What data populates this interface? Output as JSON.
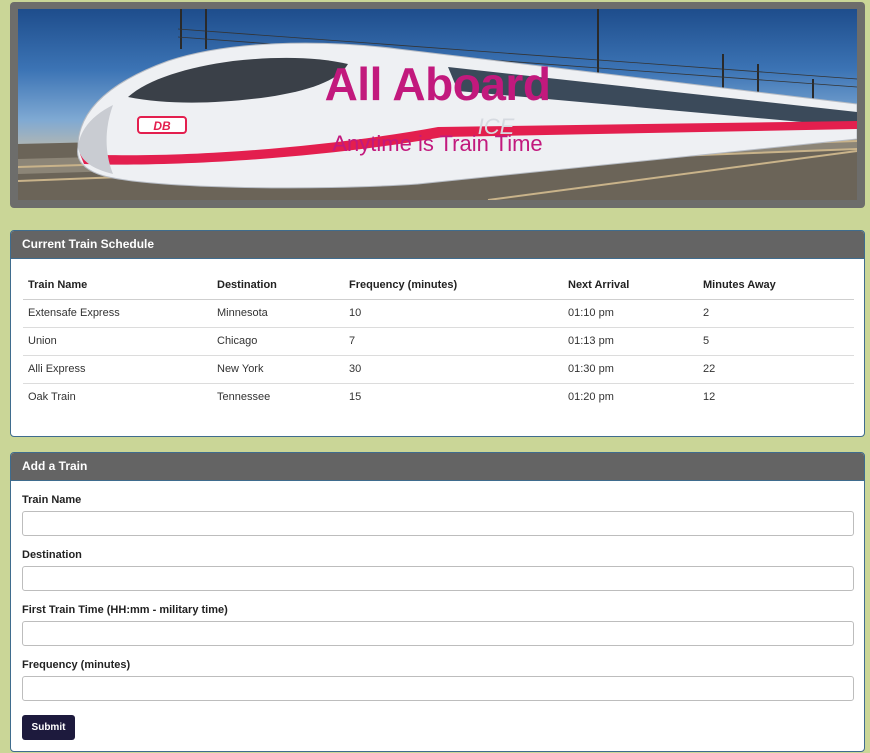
{
  "hero": {
    "title": "All Aboard",
    "subtitle": "Anytime is Train Time",
    "image_icon": "high-speed-train-image",
    "train_badge": "DB",
    "train_logo": "ICE"
  },
  "schedule": {
    "heading": "Current Train Schedule",
    "columns": [
      "Train Name",
      "Destination",
      "Frequency (minutes)",
      "Next Arrival",
      "Minutes Away"
    ],
    "rows": [
      [
        "Extensafe Express",
        "Minnesota",
        "10",
        "01:10 pm",
        "2"
      ],
      [
        "Union",
        "Chicago",
        "7",
        "01:13 pm",
        "5"
      ],
      [
        "Alli Express",
        "New York",
        "30",
        "01:30 pm",
        "22"
      ],
      [
        "Oak Train",
        "Tennessee",
        "15",
        "01:20 pm",
        "12"
      ]
    ]
  },
  "add_train": {
    "heading": "Add a Train",
    "fields": [
      {
        "label": "Train Name",
        "value": "",
        "placeholder": ""
      },
      {
        "label": "Destination",
        "value": "",
        "placeholder": ""
      },
      {
        "label": "First Train Time (HH:mm - military time)",
        "value": "",
        "placeholder": ""
      },
      {
        "label": "Frequency (minutes)",
        "value": "",
        "placeholder": ""
      }
    ],
    "submit_label": "Submit"
  },
  "colors": {
    "page_background": "#cad697",
    "panel_heading": "#646464",
    "title_accent": "#c2197d",
    "submit_button": "#1d1a3d"
  }
}
